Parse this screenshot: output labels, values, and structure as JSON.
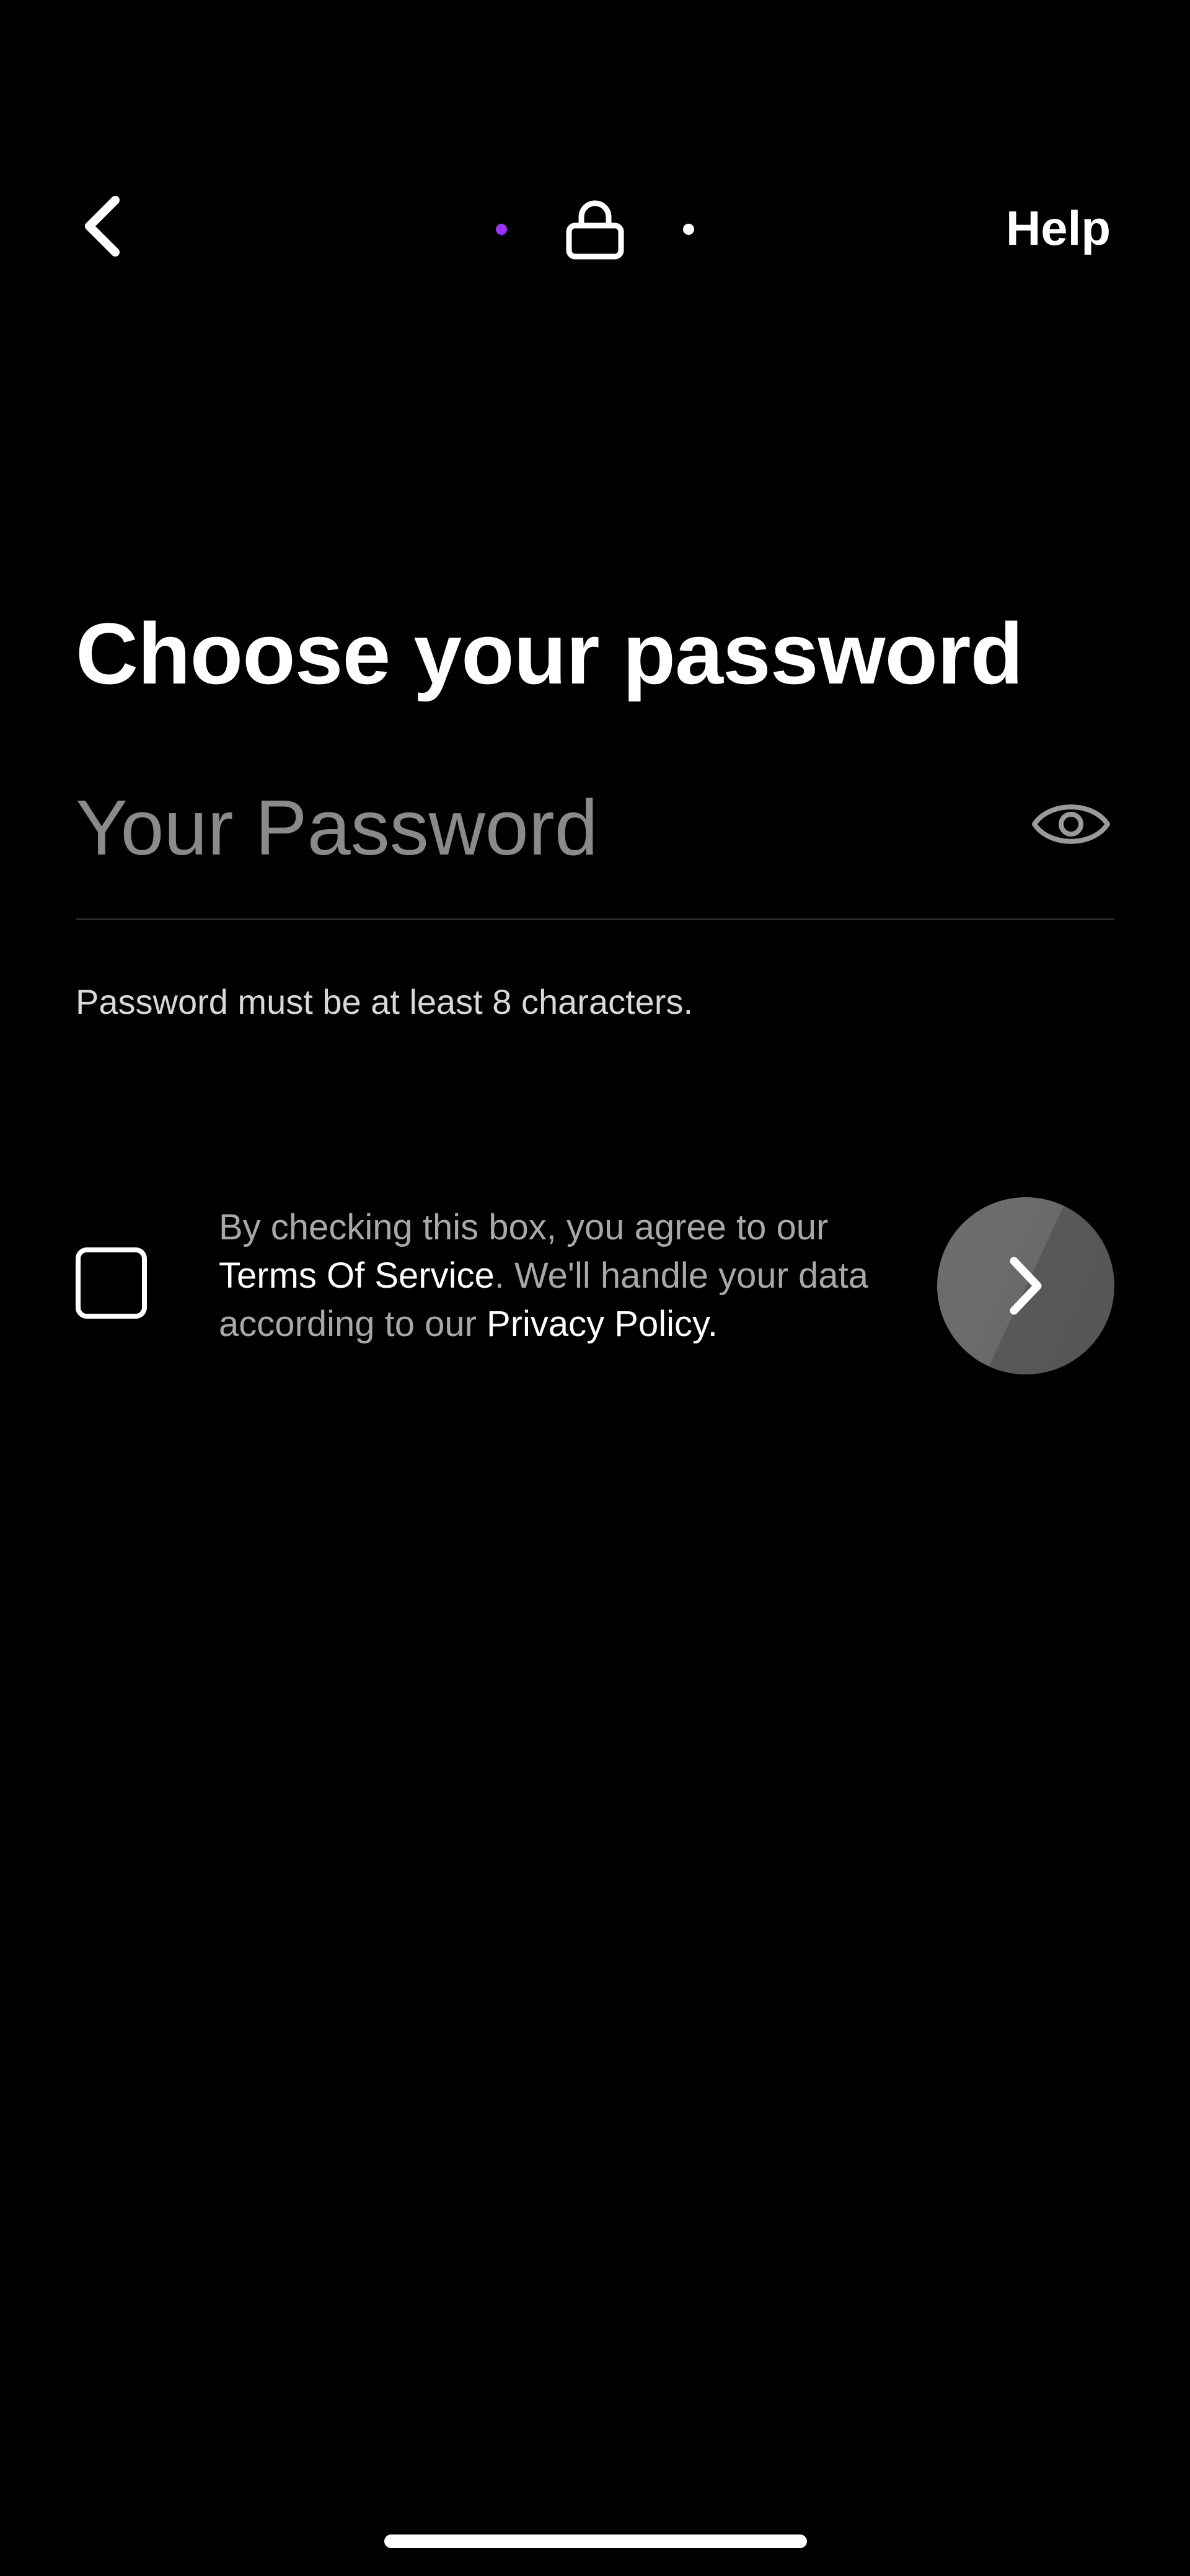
{
  "header": {
    "back_icon": "chevron-left-icon",
    "progress_icons": [
      "step-dot-active",
      "lock-icon",
      "step-dot"
    ],
    "help_label": "Help"
  },
  "main": {
    "title": "Choose your password",
    "password": {
      "placeholder": "Your Password",
      "value": "",
      "toggle_icon": "eye-icon"
    },
    "helper_text": "Password must be at least 8 characters."
  },
  "consent": {
    "checked": false,
    "text_before": "By checking this box, you agree to our ",
    "terms_link": "Terms Of Service",
    "text_middle": ". We'll handle your data according to our ",
    "privacy_link": "Privacy Policy",
    "text_after": ".",
    "next_icon": "chevron-right-icon"
  },
  "colors": {
    "background": "#000000",
    "accent": "#9B30FF",
    "muted_text": "#a8a8a8",
    "placeholder": "#8a8a8a",
    "next_button": "#666666"
  }
}
